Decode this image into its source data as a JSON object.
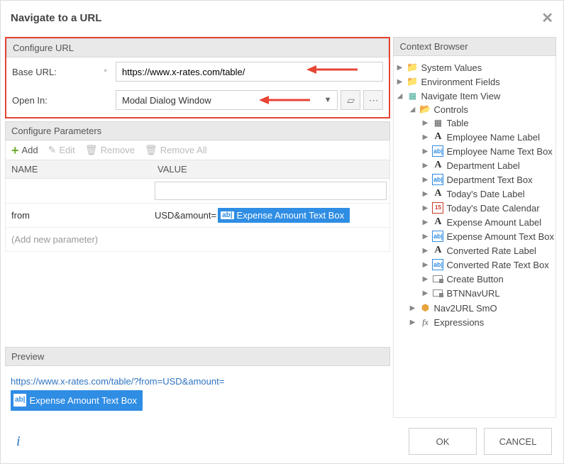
{
  "title": "Navigate to a URL",
  "configUrl": {
    "header": "Configure URL",
    "baseUrl": {
      "label": "Base URL:",
      "value": "https://www.x-rates.com/table/"
    },
    "openIn": {
      "label": "Open In:",
      "value": "Modal Dialog Window"
    }
  },
  "configParams": {
    "header": "Configure Parameters",
    "toolbar": {
      "add": "Add",
      "edit": "Edit",
      "remove": "Remove",
      "removeAll": "Remove All"
    },
    "columns": {
      "name": "NAME",
      "value": "VALUE"
    },
    "rows": [
      {
        "name": "",
        "value": "",
        "token": null
      },
      {
        "name": "from",
        "value": "USD&amount=",
        "token": "Expense Amount Text Box"
      }
    ],
    "addNew": "(Add new parameter)"
  },
  "preview": {
    "header": "Preview",
    "url": "https://www.x-rates.com/table/?from=USD&amount=",
    "token": "Expense Amount Text Box"
  },
  "contextBrowser": {
    "header": "Context Browser",
    "systemValues": "System Values",
    "environmentFields": "Environment Fields",
    "navigateItemView": "Navigate Item View",
    "controls": "Controls",
    "items": [
      {
        "icon": "table",
        "label": "Table"
      },
      {
        "icon": "A",
        "label": "Employee Name Label"
      },
      {
        "icon": "ab",
        "label": "Employee Name Text Box"
      },
      {
        "icon": "A",
        "label": "Department Label"
      },
      {
        "icon": "ab",
        "label": "Department Text Box"
      },
      {
        "icon": "A",
        "label": "Today's Date Label"
      },
      {
        "icon": "cal",
        "label": "Today's Date Calendar"
      },
      {
        "icon": "A",
        "label": "Expense Amount Label"
      },
      {
        "icon": "ab",
        "label": "Expense Amount Text Box"
      },
      {
        "icon": "A",
        "label": "Converted Rate Label"
      },
      {
        "icon": "ab",
        "label": "Converted Rate Text Box"
      },
      {
        "icon": "btn",
        "label": "Create Button"
      },
      {
        "icon": "btn",
        "label": "BTNNavURL"
      }
    ],
    "nav2url": "Nav2URL SmO",
    "expressions": "Expressions"
  },
  "footer": {
    "ok": "OK",
    "cancel": "CANCEL"
  }
}
